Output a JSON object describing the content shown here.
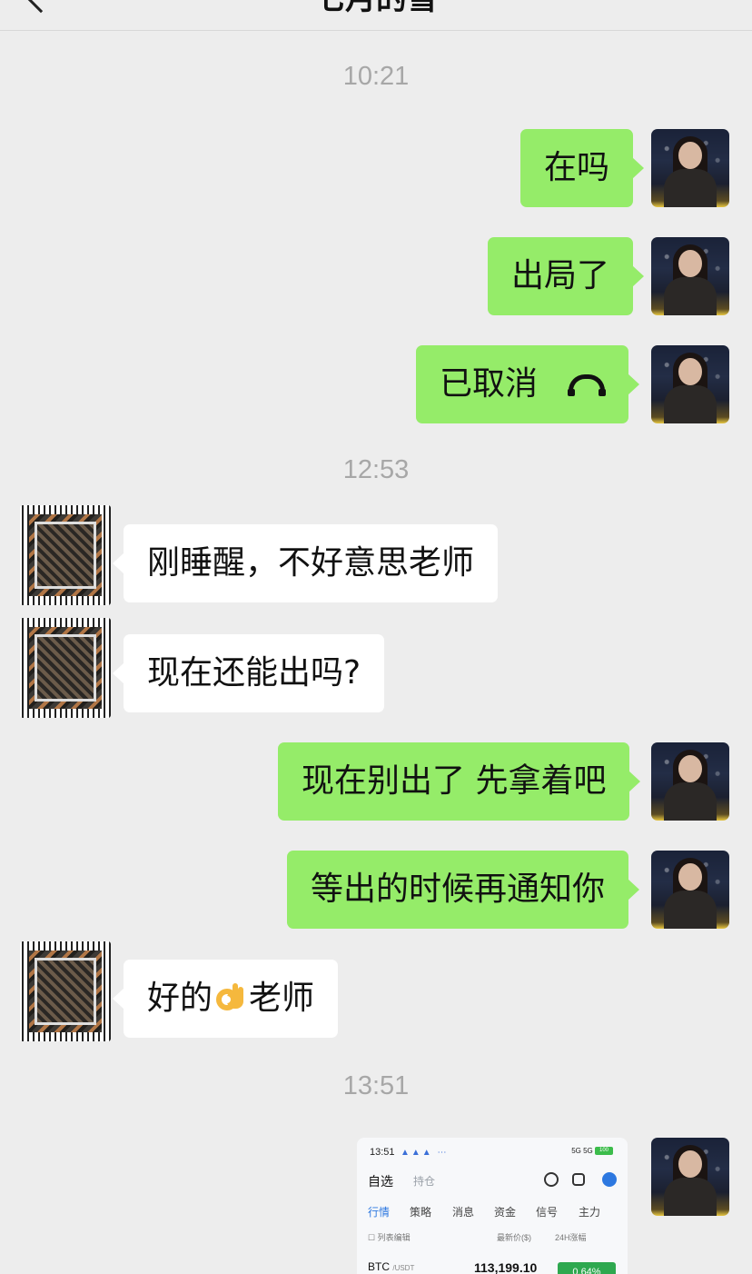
{
  "header": {
    "title": "七月的雪"
  },
  "times": [
    "10:21",
    "12:53",
    "13:51"
  ],
  "messages": {
    "m1": "在吗",
    "m2": "出局了",
    "m3": "已取消",
    "m4": "刚睡醒，不好意思老师",
    "m5": "现在还能出吗?",
    "m6": "现在别出了 先拿着吧",
    "m7": "等出的时候再通知你",
    "m8a": "好的",
    "m8b": "老师"
  },
  "icons": {
    "back": "chevron-left-icon",
    "call": "hang-up-phone-icon",
    "emoji": "ok-hand-emoji"
  },
  "colors": {
    "bubble_me": "#95ec69",
    "bubble_them": "#ffffff",
    "background": "#ededed"
  },
  "screenshot": {
    "status_time": "13:51",
    "status_right": "5G 5G",
    "battery": "100",
    "tab_selected": "自选",
    "tab_other": "持仓",
    "nav": [
      "行情",
      "策略",
      "消息",
      "资金",
      "信号",
      "主力"
    ],
    "edit_label": "列表编辑",
    "price_header": "最新价($)",
    "change_header": "24H涨幅",
    "coin": "BTC",
    "pair": "/USDT",
    "price": "113,199.10",
    "change": "0.64%"
  }
}
